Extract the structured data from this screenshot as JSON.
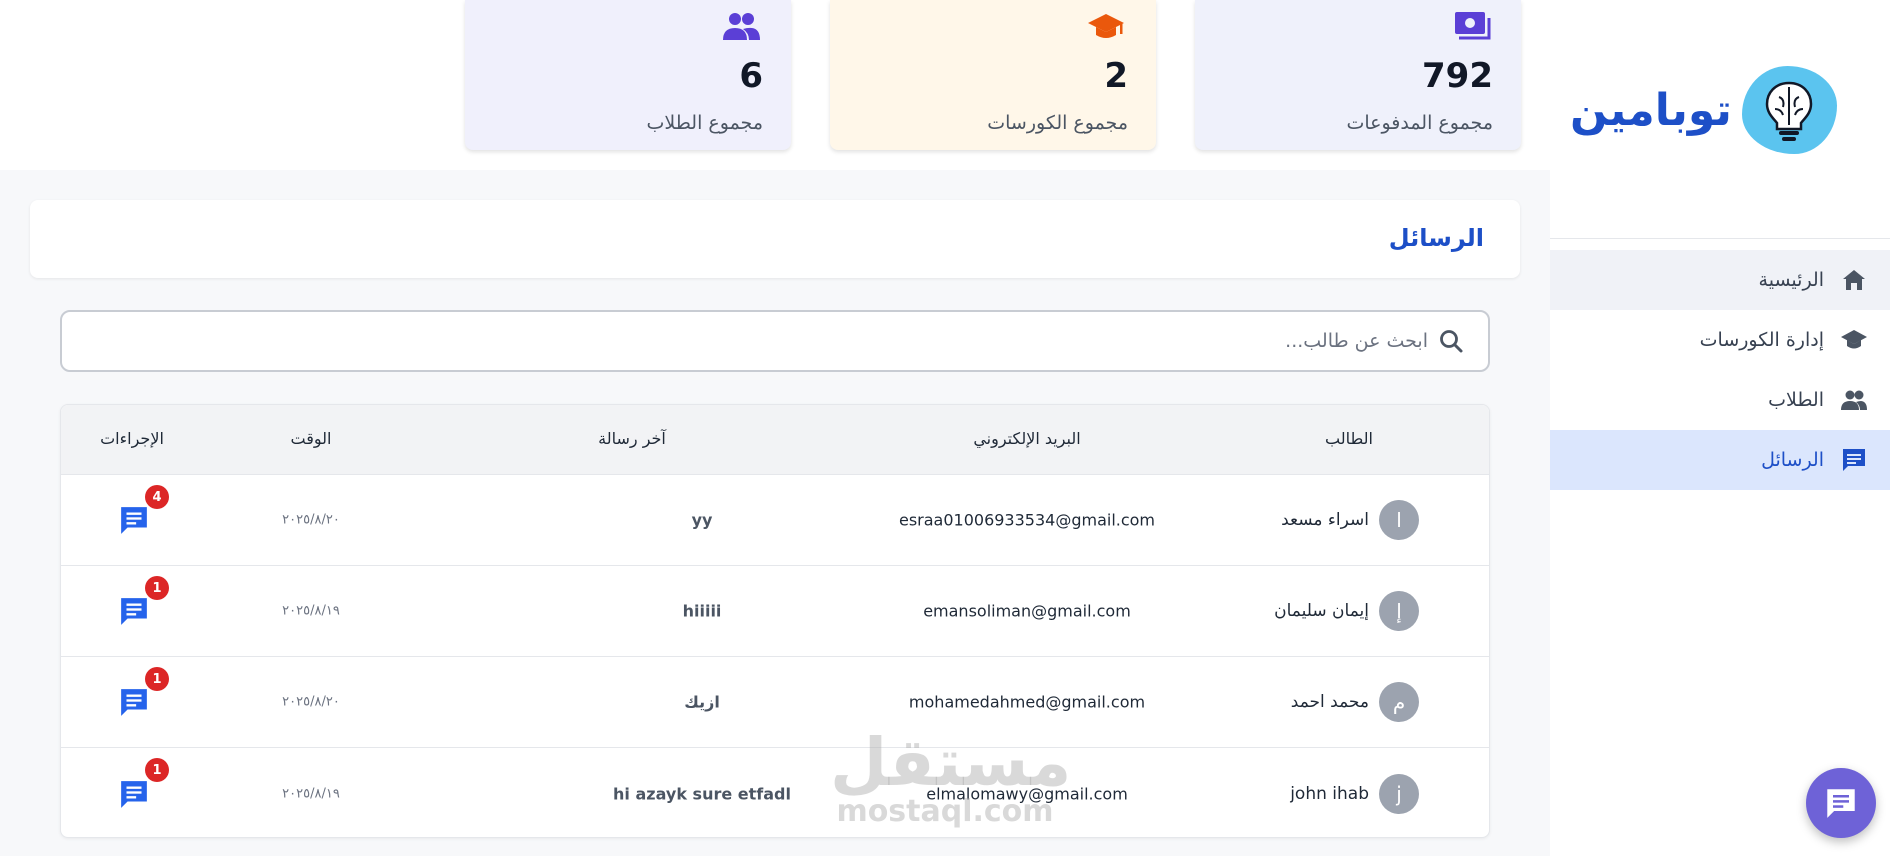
{
  "app": {
    "logo_text": "توبامين"
  },
  "sidebar": {
    "items": [
      {
        "label": "الرئيسية",
        "icon": "home-icon"
      },
      {
        "label": "إدارة الكورسات",
        "icon": "graduation-cap-icon"
      },
      {
        "label": "الطلاب",
        "icon": "people-icon"
      },
      {
        "label": "الرسائل",
        "icon": "message-icon",
        "active": true
      }
    ]
  },
  "stats": {
    "payments": {
      "value": "792",
      "label": "مجموع المدفوعات",
      "icon": "payments-icon"
    },
    "courses": {
      "value": "2",
      "label": "مجموع الكورسات",
      "icon": "graduation-cap-icon"
    },
    "students": {
      "value": "6",
      "label": "مجموع الطلاب",
      "icon": "people-icon"
    }
  },
  "messages": {
    "title": "الرسائل",
    "search_placeholder": "ابحث عن طالب...",
    "columns": {
      "student": "الطالب",
      "email": "البريد الإلكتروني",
      "last_message": "آخر رسالة",
      "time": "الوقت",
      "actions": "الإجراءات"
    },
    "rows": [
      {
        "initial": "ا",
        "name": "اسراء مسعد",
        "email": "esraa01006933534@gmail.com",
        "last_message": "yy",
        "time": "٢٠٢٥/٨/٢٠",
        "unread": "4"
      },
      {
        "initial": "إ",
        "name": "إيمان سليمان",
        "email": "emansoliman@gmail.com",
        "last_message": "hiiiii",
        "time": "٢٠٢٥/٨/١٩",
        "unread": "1"
      },
      {
        "initial": "م",
        "name": "محمد احمد",
        "email": "mohamedahmed@gmail.com",
        "last_message": "ازيك",
        "time": "٢٠٢٥/٨/٢٠",
        "unread": "1"
      },
      {
        "initial": "j",
        "name": "john ihab",
        "email": "elmalomawy@gmail.com",
        "last_message": "hi azayk sure etfadl",
        "time": "٢٠٢٥/٨/١٩",
        "unread": "1"
      }
    ]
  },
  "watermark": {
    "arabic": "مستقل",
    "latin": "mostaql.com"
  },
  "colors": {
    "brand": "#1d4fc7",
    "action": "#2563eb",
    "badge": "#dc2626",
    "fab": "#6e62d7",
    "stat_icon_purple": "#5b3fd6",
    "stat_icon_orange": "#ea580c"
  }
}
